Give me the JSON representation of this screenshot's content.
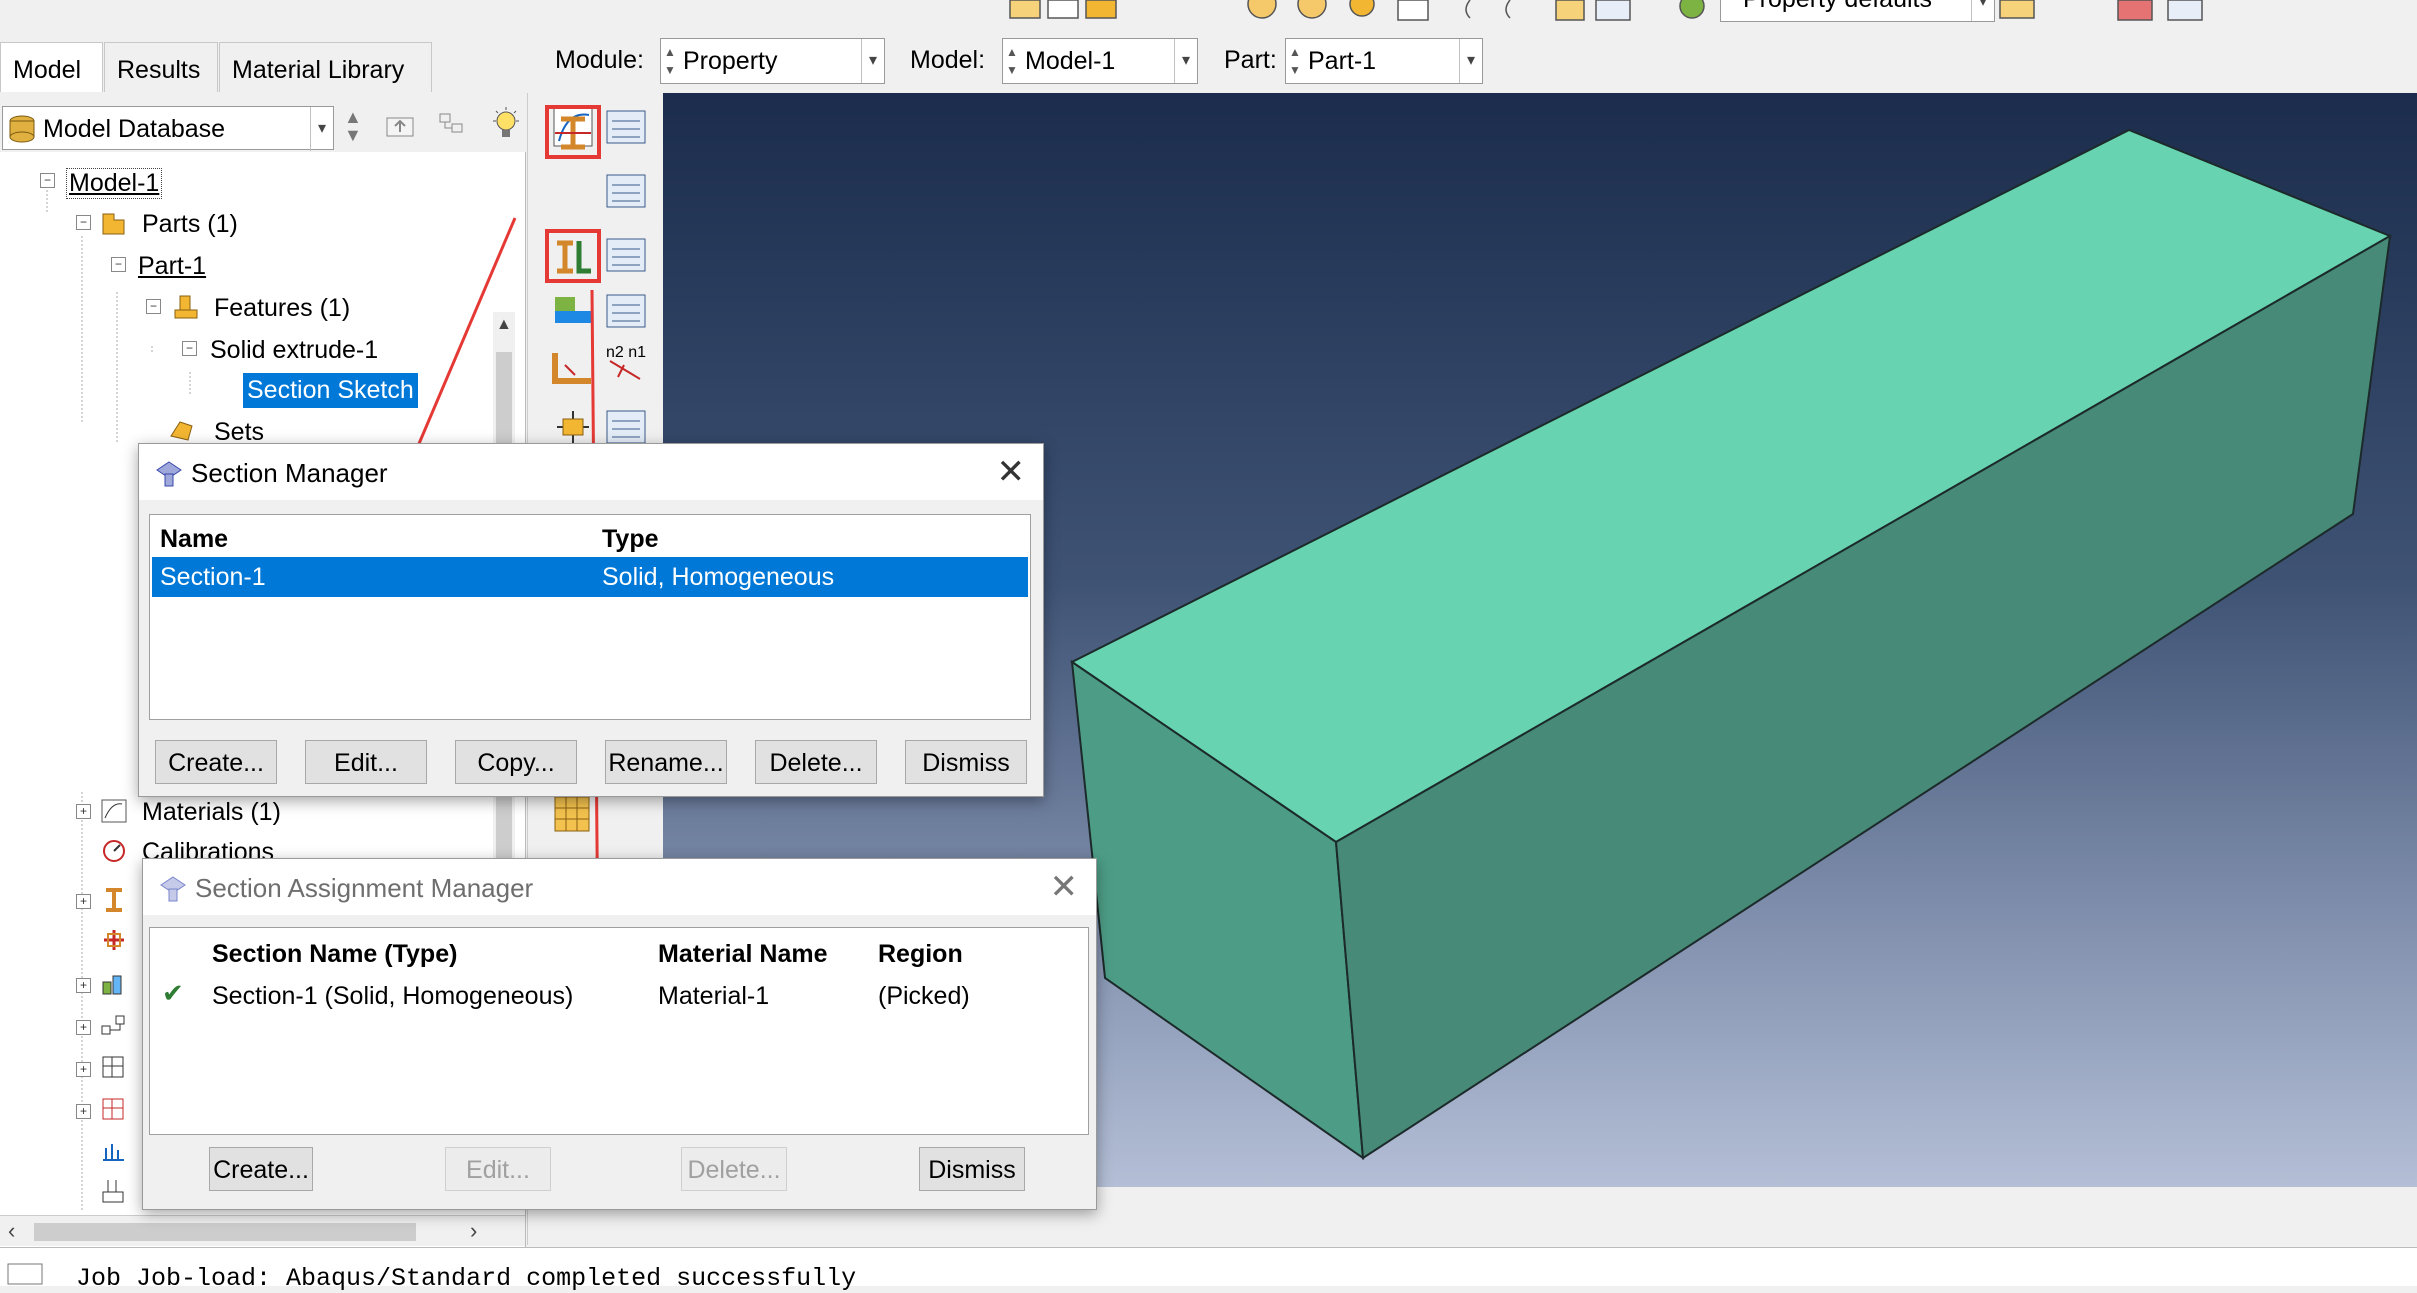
{
  "top_toolbar": {
    "render_style_value": "Property defaults"
  },
  "tabs": [
    "Model",
    "Results",
    "Material Library"
  ],
  "context_bar": {
    "module_label": "Module:",
    "module_value": "Property",
    "model_label": "Model:",
    "model_value": "Model-1",
    "part_label": "Part:",
    "part_value": "Part-1"
  },
  "tree_header": {
    "database": "Model Database"
  },
  "tree": {
    "model": "Model-1",
    "parts": "Parts (1)",
    "part": "Part-1",
    "features": "Features (1)",
    "solid_extrude": "Solid extrude-1",
    "section_sketch": "Section Sketch",
    "sets": "Sets",
    "materials": "Materials (1)",
    "calibrations": "Calibrations"
  },
  "section_manager": {
    "title": "Section Manager",
    "columns": [
      "Name",
      "Type"
    ],
    "rows": [
      {
        "name": "Section-1",
        "type": "Solid, Homogeneous"
      }
    ],
    "buttons": [
      "Create...",
      "Edit...",
      "Copy...",
      "Rename...",
      "Delete...",
      "Dismiss"
    ]
  },
  "section_assignment_manager": {
    "title": "Section Assignment Manager",
    "columns": [
      "Section Name (Type)",
      "Material Name",
      "Region"
    ],
    "rows": [
      {
        "section": "Section-1 (Solid, Homogeneous)",
        "material": "Material-1",
        "region": "(Picked)"
      }
    ],
    "buttons": [
      "Create...",
      "Edit...",
      "Delete...",
      "Dismiss"
    ]
  },
  "message_area": {
    "line1": "Job Job-load: Abaqus/Standard completed successfully"
  },
  "colors": {
    "part_top": "#67d3b0",
    "part_front": "#4d9d86",
    "part_side": "#468a77",
    "selection_blue": "#0078d7",
    "highlight_red": "#e53935"
  }
}
